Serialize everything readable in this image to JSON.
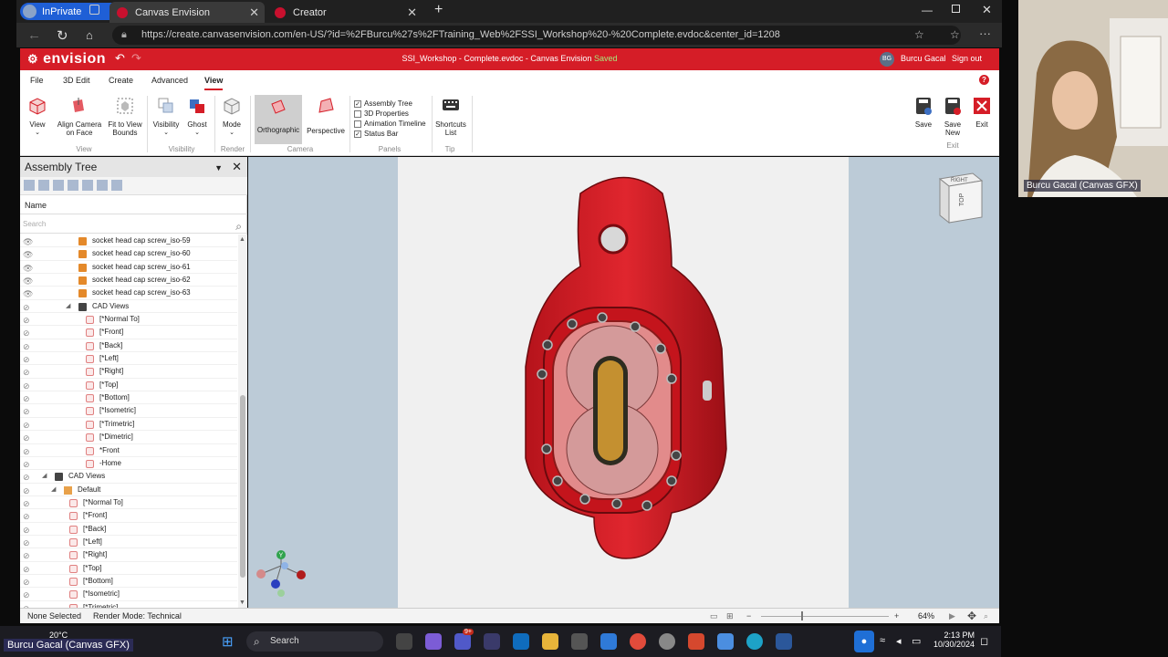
{
  "browser": {
    "inprivate_label": "InPrivate",
    "tabs": [
      {
        "label": "Canvas Envision"
      },
      {
        "label": "Creator"
      }
    ],
    "url": "https://create.canvasenvision.com/en-US/?id=%2FBurcu%27s%2FTraining_Web%2FSSI_Workshop%20-%20Complete.evdoc&center_id=1208"
  },
  "app": {
    "logo": "envision",
    "document_title": "SSI_Workshop - Complete.evdoc - Canvas Envision",
    "saved_label": "Saved",
    "user_initials": "BG",
    "user_name": "Burcu Gacal",
    "sign_out": "Sign out",
    "accent": "#d51d27"
  },
  "menu": {
    "tabs": [
      "File",
      "3D Edit",
      "Create",
      "Advanced",
      "View"
    ],
    "selected": "View"
  },
  "ribbon": {
    "view_label": "View",
    "align_label_1": "Align Camera",
    "align_label_2": "on Face",
    "fit_label_1": "Fit to View",
    "fit_label_2": "Bounds",
    "visibility_label": "Visibility",
    "ghost_label": "Ghost",
    "mode_label": "Mode",
    "ortho_label": "Orthographic",
    "persp_label": "Perspective",
    "checks": [
      {
        "label": "Assembly Tree",
        "checked": true
      },
      {
        "label": "3D Properties",
        "checked": false
      },
      {
        "label": "Animation Timeline",
        "checked": false
      },
      {
        "label": "Status Bar",
        "checked": true
      }
    ],
    "shortcuts_label_1": "Shortcuts",
    "shortcuts_label_2": "List",
    "save_label": "Save",
    "save_new_label_1": "Save",
    "save_new_label_2": "New",
    "exit_label": "Exit",
    "groups": {
      "view": "View",
      "visibility": "Visibility",
      "render": "Render",
      "camera": "Camera",
      "panels": "Panels",
      "tip": "Tip",
      "exit": "Exit"
    }
  },
  "panel": {
    "title": "Assembly Tree",
    "name_header": "Name",
    "search_placeholder": "Search",
    "rows": [
      {
        "label": "socket head cap screw_iso-59",
        "icon": "box",
        "indent": 64
      },
      {
        "label": "socket head cap screw_iso-60",
        "icon": "box",
        "indent": 64
      },
      {
        "label": "socket head cap screw_iso-61",
        "icon": "box",
        "indent": 64
      },
      {
        "label": "socket head cap screw_iso-62",
        "icon": "box",
        "indent": 64
      },
      {
        "label": "socket head cap screw_iso-63",
        "icon": "box",
        "indent": 64
      },
      {
        "label": "CAD Views",
        "icon": "cam",
        "indent": 64,
        "arrow": true
      },
      {
        "label": "[*Normal To]",
        "icon": "view",
        "indent": 72
      },
      {
        "label": "[*Front]",
        "icon": "view",
        "indent": 72
      },
      {
        "label": "[*Back]",
        "icon": "view",
        "indent": 72
      },
      {
        "label": "[*Left]",
        "icon": "view",
        "indent": 72
      },
      {
        "label": "[*Right]",
        "icon": "view",
        "indent": 72
      },
      {
        "label": "[*Top]",
        "icon": "view",
        "indent": 72
      },
      {
        "label": "[*Bottom]",
        "icon": "view",
        "indent": 72
      },
      {
        "label": "[*Isometric]",
        "icon": "view",
        "indent": 72
      },
      {
        "label": "[*Trimetric]",
        "icon": "view",
        "indent": 72
      },
      {
        "label": "[*Dimetric]",
        "icon": "view",
        "indent": 72
      },
      {
        "label": "*Front",
        "icon": "view",
        "indent": 72
      },
      {
        "label": "-Home",
        "icon": "view",
        "indent": 72
      },
      {
        "label": "CAD Views",
        "icon": "cam",
        "indent": 38,
        "arrow": true
      },
      {
        "label": "Default",
        "icon": "cfg",
        "indent": 48,
        "arrow": true
      },
      {
        "label": "[*Normal To]",
        "icon": "view",
        "indent": 54
      },
      {
        "label": "[*Front]",
        "icon": "view",
        "indent": 54
      },
      {
        "label": "[*Back]",
        "icon": "view",
        "indent": 54
      },
      {
        "label": "[*Left]",
        "icon": "view",
        "indent": 54
      },
      {
        "label": "[*Right]",
        "icon": "view",
        "indent": 54
      },
      {
        "label": "[*Top]",
        "icon": "view",
        "indent": 54
      },
      {
        "label": "[*Bottom]",
        "icon": "view",
        "indent": 54
      },
      {
        "label": "[*Isometric]",
        "icon": "view",
        "indent": 54
      },
      {
        "label": "[*Trimetric]",
        "icon": "view",
        "indent": 54
      }
    ]
  },
  "viewcube": {
    "face_top": "RIGHT",
    "face_front": "TOP"
  },
  "axes": {
    "y": "Y"
  },
  "status": {
    "selection": "None Selected",
    "render_mode": "Render Mode: Technical",
    "zoom": "64%"
  },
  "video": {
    "name": "Burcu Gacal (Canvas GFX)"
  },
  "taskbar": {
    "weather": "20°C",
    "search": "Search",
    "time": "2:13 PM",
    "date": "10/30/2024",
    "badge": "9+"
  },
  "overlay_name": "Burcu Gacal (Canvas GFX)"
}
